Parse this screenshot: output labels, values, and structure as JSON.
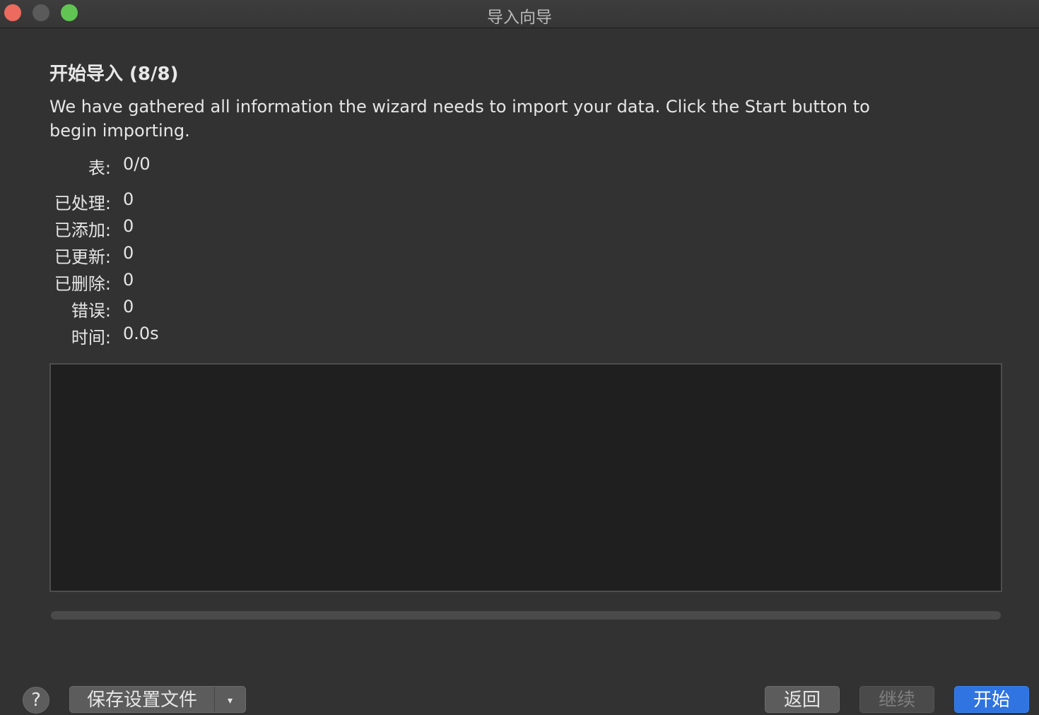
{
  "window": {
    "title": "导入向导"
  },
  "step": {
    "heading": "开始导入 (8/8)",
    "description": "We have gathered all information the wizard needs to import your data. Click the Start button to begin importing."
  },
  "stats": [
    {
      "label": "表:",
      "value": "0/0"
    },
    {
      "label": "已处理:",
      "value": "0"
    },
    {
      "label": "已添加:",
      "value": "0"
    },
    {
      "label": "已更新:",
      "value": "0"
    },
    {
      "label": "已删除:",
      "value": "0"
    },
    {
      "label": "错误:",
      "value": "0"
    },
    {
      "label": "时间:",
      "value": "0.0s"
    }
  ],
  "log": {
    "content": ""
  },
  "progress": {
    "fraction": 0
  },
  "buttons": {
    "help": "?",
    "save_profile": "保存设置文件",
    "save_dropdown_icon": "▾",
    "back": "返回",
    "next": "继续",
    "start": "开始"
  },
  "colors": {
    "background": "#323232",
    "log_background": "#1f1f1f",
    "accent": "#2f74e0",
    "close": "#ed6a5e",
    "maximize": "#61c554"
  }
}
